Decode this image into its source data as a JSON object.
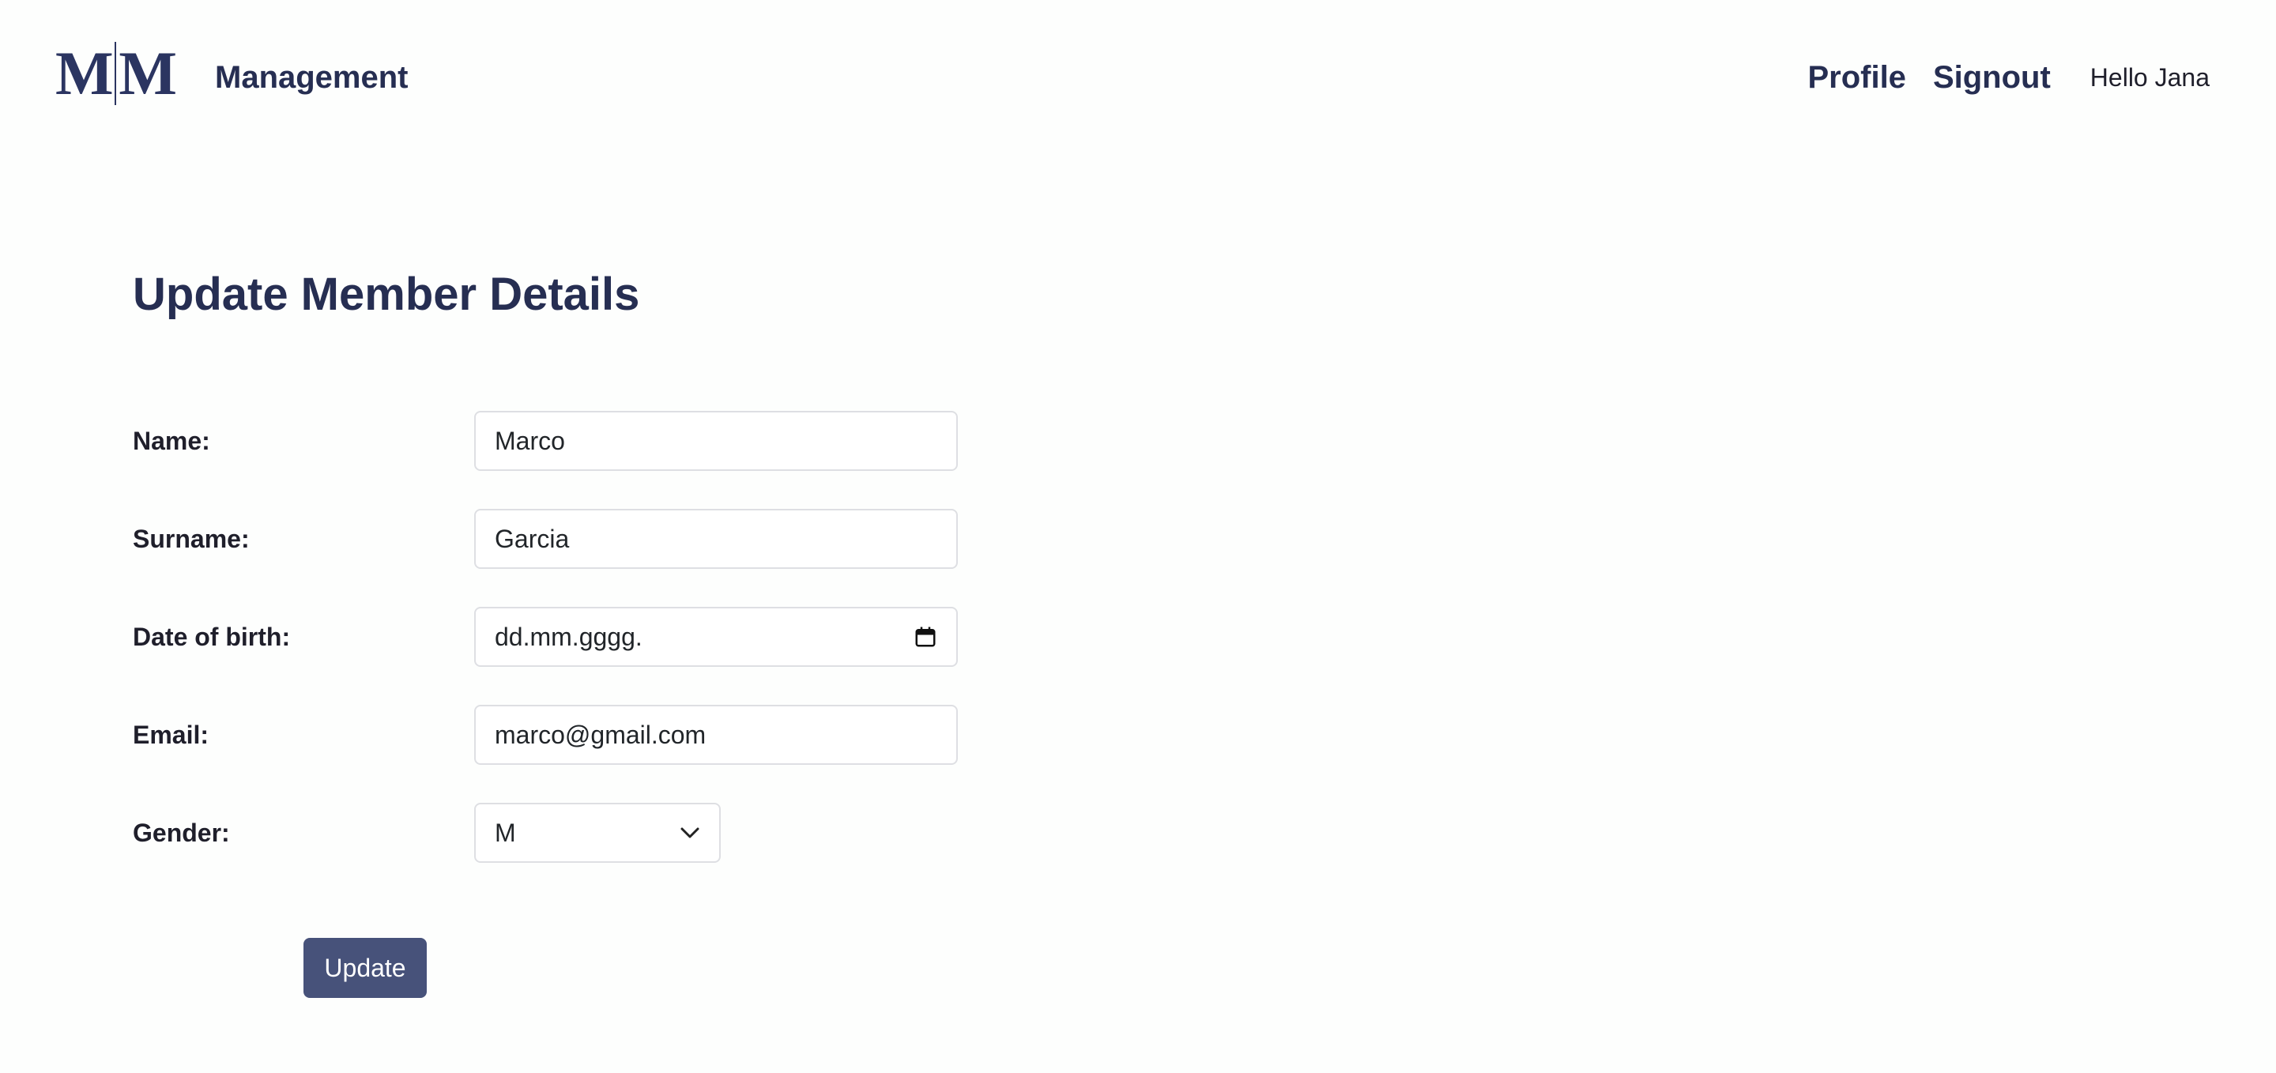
{
  "header": {
    "logo_text": "M|M",
    "brand": "Management",
    "nav": {
      "profile": "Profile",
      "signout": "Signout"
    },
    "greeting": "Hello Jana"
  },
  "page": {
    "title": "Update Member Details"
  },
  "form": {
    "name": {
      "label": "Name:",
      "value": "Marco"
    },
    "surname": {
      "label": "Surname:",
      "value": "Garcia"
    },
    "dob": {
      "label": "Date of birth:",
      "value": "dd.mm.gggg."
    },
    "email": {
      "label": "Email:",
      "value": "marco@gmail.com"
    },
    "gender": {
      "label": "Gender:",
      "value": "M"
    },
    "submit_label": "Update"
  },
  "colors": {
    "brand_navy": "#262e52",
    "button_bg": "#47527a",
    "page_bg": "#fdfefd"
  },
  "icons": {
    "date": "calendar-icon",
    "select": "chevron-down-icon"
  }
}
